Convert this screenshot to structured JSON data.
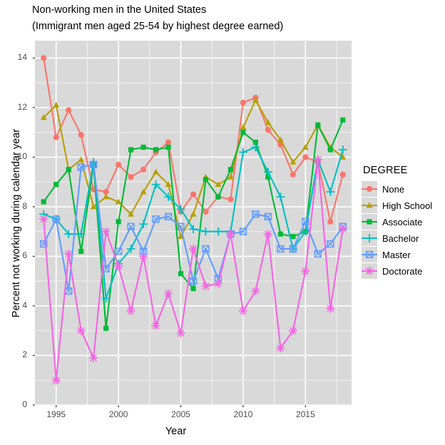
{
  "chart_data": {
    "type": "line",
    "title": "Non-working men in the United States",
    "subtitle": "(Immigrant men aged 25-54 by highest degree earned)",
    "xlabel": "Year",
    "ylabel": "Percent not working during calendar year",
    "legend_title": "DEGREE",
    "legend_position": "right",
    "grid": true,
    "xlim": [
      1993.3,
      2018.7
    ],
    "ylim": [
      0,
      14.7
    ],
    "xticks": [
      1995,
      2000,
      2005,
      2010,
      2015
    ],
    "yticks": [
      0,
      2,
      4,
      6,
      8,
      10,
      12,
      14
    ],
    "x": [
      1994,
      1995,
      1996,
      1997,
      1998,
      1999,
      2000,
      2001,
      2002,
      2003,
      2004,
      2005,
      2006,
      2007,
      2008,
      2009,
      2010,
      2011,
      2012,
      2013,
      2014,
      2015,
      2016,
      2017,
      2018
    ],
    "series": [
      {
        "name": "None",
        "color": "#F8766D",
        "shape": "circle",
        "values": [
          14.0,
          10.8,
          11.9,
          10.9,
          8.7,
          8.6,
          9.7,
          9.2,
          9.5,
          10.2,
          10.6,
          7.8,
          8.5,
          7.8,
          8.4,
          8.3,
          12.2,
          12.4,
          11.1,
          10.5,
          9.3,
          10.0,
          9.8,
          7.4,
          9.3
        ]
      },
      {
        "name": "High School",
        "color": "#B79F00",
        "shape": "triangle",
        "values": [
          11.6,
          12.1,
          9.5,
          9.9,
          8.0,
          8.4,
          8.2,
          7.7,
          8.6,
          9.4,
          8.9,
          6.8,
          7.7,
          9.2,
          8.9,
          9.2,
          11.2,
          12.3,
          11.4,
          10.7,
          9.8,
          10.4,
          11.3,
          10.4,
          10.0
        ]
      },
      {
        "name": "Associate",
        "color": "#00BA38",
        "shape": "square",
        "values": [
          8.2,
          8.9,
          9.5,
          6.2,
          9.7,
          3.1,
          7.4,
          10.3,
          10.4,
          10.3,
          10.4,
          5.3,
          4.7,
          9.1,
          8.4,
          9.5,
          11.0,
          10.6,
          9.2,
          6.9,
          6.8,
          7.0,
          11.3,
          10.3,
          11.5
        ]
      },
      {
        "name": "Bachelor",
        "color": "#00BFC4",
        "shape": "plus",
        "values": [
          7.7,
          7.5,
          6.9,
          6.9,
          9.8,
          4.3,
          5.7,
          6.3,
          7.3,
          8.9,
          8.4,
          7.9,
          7.1,
          7.0,
          7.0,
          7.0,
          10.2,
          10.4,
          9.4,
          8.4,
          6.3,
          7.0,
          9.9,
          8.6,
          10.3
        ]
      },
      {
        "name": "Master",
        "color": "#619CFF",
        "shape": "square-cross",
        "values": [
          6.5,
          7.5,
          4.6,
          9.6,
          9.7,
          5.5,
          6.2,
          7.2,
          6.2,
          7.5,
          7.6,
          7.2,
          5.0,
          6.3,
          5.1,
          6.9,
          7.0,
          7.7,
          7.6,
          6.3,
          6.3,
          7.4,
          6.1,
          6.5,
          7.2
        ]
      },
      {
        "name": "Doctorate",
        "color": "#F564E3",
        "shape": "asterisk",
        "values": [
          7.5,
          1.0,
          6.1,
          3.0,
          1.9,
          7.0,
          5.6,
          3.8,
          6.0,
          3.2,
          4.5,
          2.9,
          6.3,
          4.8,
          4.9,
          6.9,
          3.8,
          4.6,
          6.9,
          2.3,
          3.0,
          5.4,
          9.9,
          3.9,
          7.1
        ]
      }
    ]
  },
  "legend": {
    "title": "DEGREE",
    "items": [
      {
        "label": "None"
      },
      {
        "label": "High School"
      },
      {
        "label": "Associate"
      },
      {
        "label": "Bachelor"
      },
      {
        "label": "Master"
      },
      {
        "label": "Doctorate"
      }
    ]
  },
  "theme": {
    "panel_background": "#D9D9D9",
    "grid_major": "#FFFFFF",
    "grid_minor": "#F2F2F2",
    "text_color": "#4D4D4D",
    "tick_color": "#333333"
  }
}
